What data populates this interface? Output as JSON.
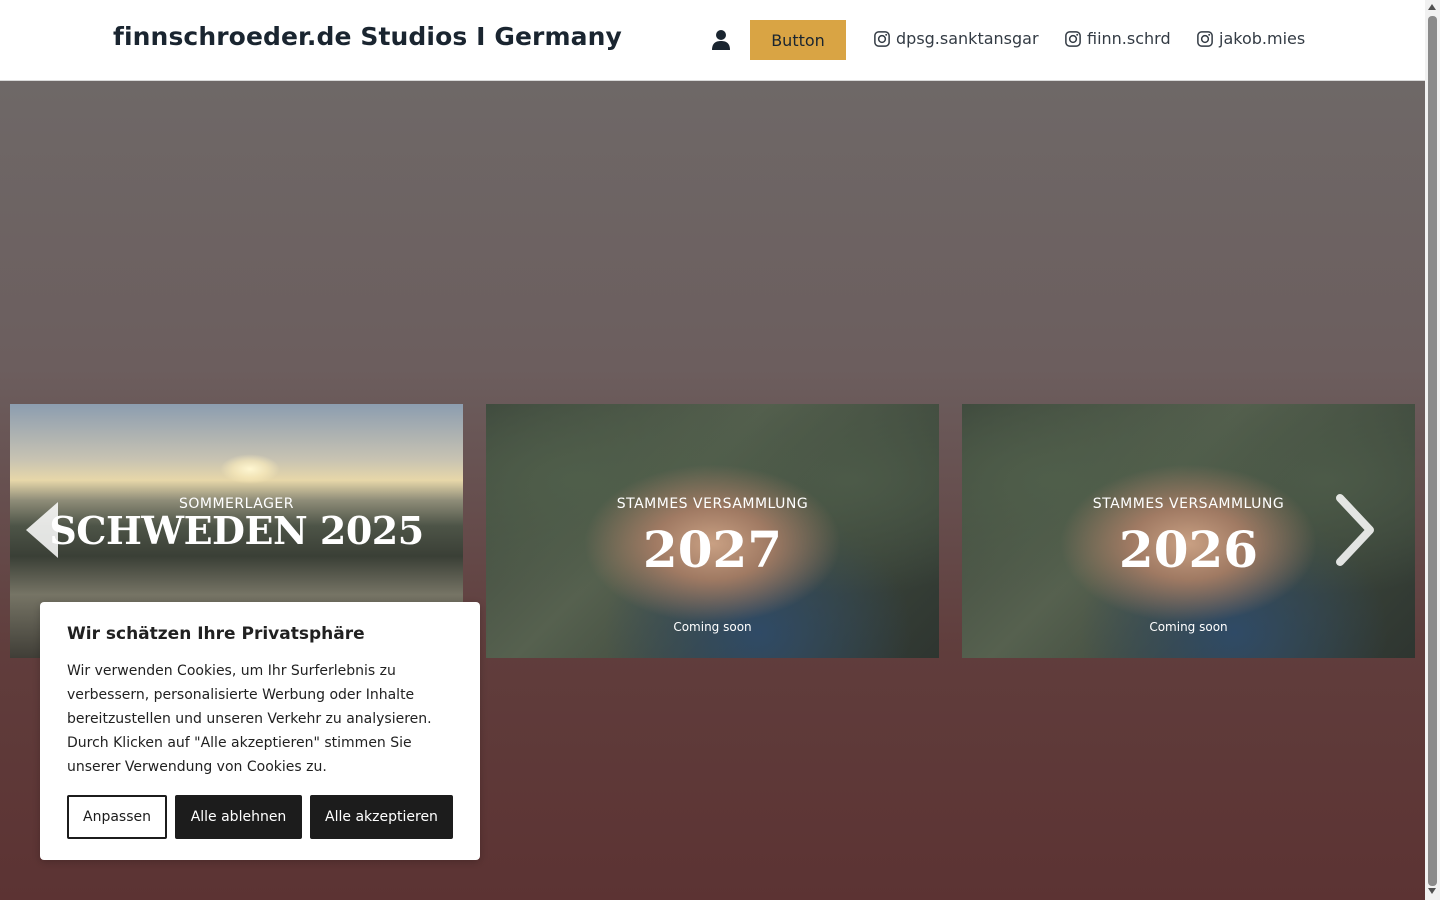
{
  "header": {
    "site_title": "finnschroeder.de Studios I Germany",
    "user_icon": "user-icon",
    "button_label": "Button",
    "button_color": "#d9a444",
    "socials": [
      {
        "icon": "instagram-icon",
        "label": "dpsg.sanktansgar"
      },
      {
        "icon": "instagram-icon",
        "label": "fiinn.schrd"
      },
      {
        "icon": "instagram-icon",
        "label": "jakob.mies"
      }
    ]
  },
  "slider": {
    "slides": [
      {
        "kicker": "SOMMERLAGER",
        "title": "SCHWEDEN 2025",
        "subtitle": ""
      },
      {
        "kicker": "STAMMES VERSAMMLUNG",
        "title": "2027",
        "subtitle": "Coming soon"
      },
      {
        "kicker": "STAMMES VERSAMMLUNG",
        "title": "2026",
        "subtitle": "Coming soon"
      }
    ],
    "prev_icon": "chevron-left-icon",
    "next_icon": "chevron-right-icon"
  },
  "cookie_banner": {
    "title": "Wir schätzen Ihre Privatsphäre",
    "text": "Wir verwenden Cookies, um Ihr Surferlebnis zu verbessern, personalisierte Werbung oder Inhalte bereitzustellen und unseren Verkehr zu analysieren. Durch Klicken auf \"Alle akzeptieren\" stimmen Sie unserer Verwendung von Cookies zu.",
    "customize_label": "Anpassen",
    "reject_label": "Alle ablehnen",
    "accept_label": "Alle akzeptieren"
  }
}
